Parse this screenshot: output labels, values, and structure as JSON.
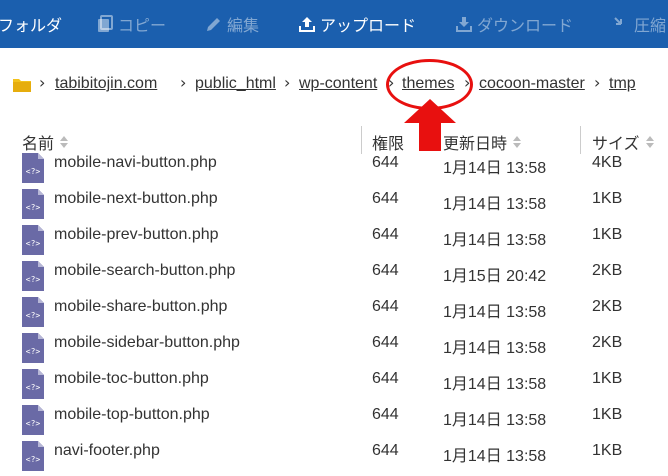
{
  "toolbar": {
    "items": [
      {
        "label": "フォルダ",
        "icon": ""
      },
      {
        "label": "コピー",
        "icon": "copy-icon"
      },
      {
        "label": "編集",
        "icon": "pencil-icon"
      },
      {
        "label": "アップロード",
        "icon": "upload-icon"
      },
      {
        "label": "ダウンロード",
        "icon": "download-icon"
      },
      {
        "label": "圧縮",
        "icon": "compress-icon"
      }
    ]
  },
  "breadcrumb": {
    "items": [
      "tabibitojin.com",
      "public_html",
      "wp-content",
      "themes",
      "cocoon-master",
      "tmp"
    ]
  },
  "table": {
    "headers": {
      "name": "名前",
      "perm": "権限",
      "date": "更新日時",
      "size": "サイズ"
    },
    "rows": [
      {
        "name": "mobile-navi-button.php",
        "perm": "644",
        "date": "1月14日 13:58",
        "size": "4KB"
      },
      {
        "name": "mobile-next-button.php",
        "perm": "644",
        "date": "1月14日 13:58",
        "size": "1KB"
      },
      {
        "name": "mobile-prev-button.php",
        "perm": "644",
        "date": "1月14日 13:58",
        "size": "1KB"
      },
      {
        "name": "mobile-search-button.php",
        "perm": "644",
        "date": "1月15日 20:42",
        "size": "2KB"
      },
      {
        "name": "mobile-share-button.php",
        "perm": "644",
        "date": "1月14日 13:58",
        "size": "2KB"
      },
      {
        "name": "mobile-sidebar-button.php",
        "perm": "644",
        "date": "1月14日 13:58",
        "size": "2KB"
      },
      {
        "name": "mobile-toc-button.php",
        "perm": "644",
        "date": "1月14日 13:58",
        "size": "1KB"
      },
      {
        "name": "mobile-top-button.php",
        "perm": "644",
        "date": "1月14日 13:58",
        "size": "1KB"
      },
      {
        "name": "navi-footer.php",
        "perm": "644",
        "date": "1月14日 13:58",
        "size": "1KB"
      }
    ]
  },
  "colors": {
    "toolbar_bg": "#1b5fae",
    "annotation_red": "#e8100f",
    "folder_yellow": "#f3c21b",
    "php_icon": "#6a6aa6"
  }
}
